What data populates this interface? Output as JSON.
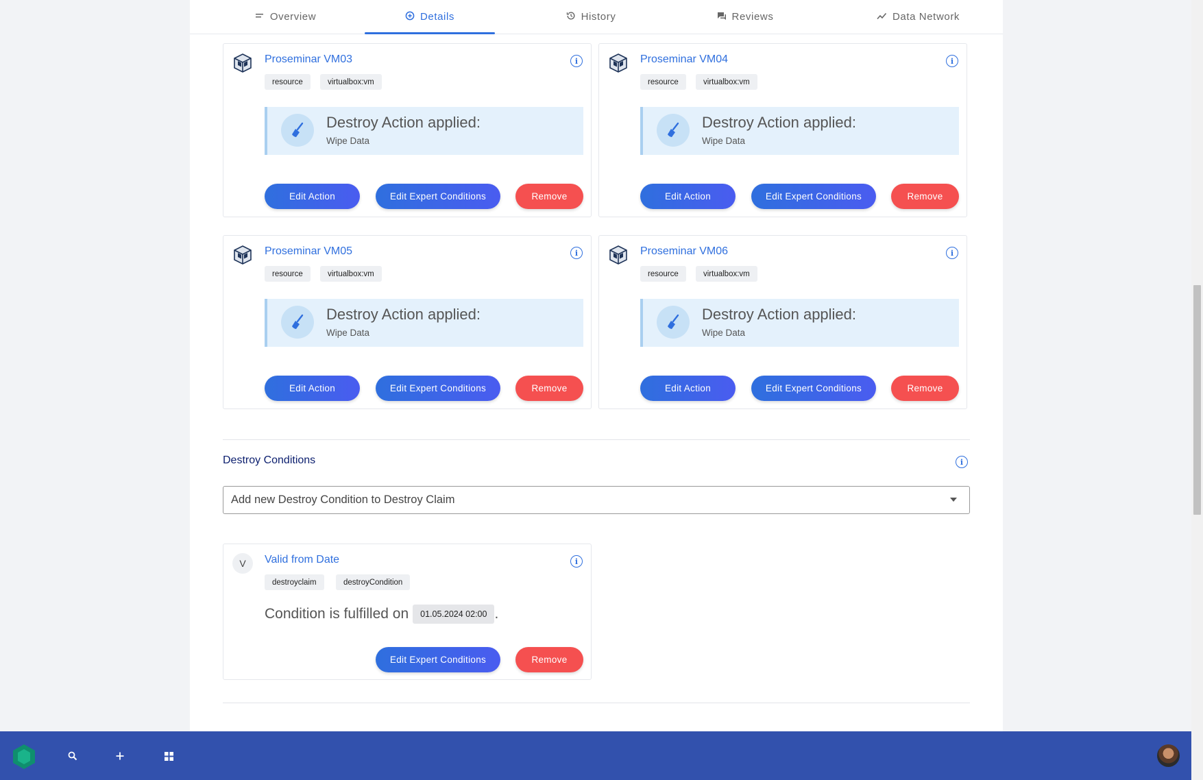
{
  "tabs": [
    {
      "label": "Overview",
      "icon": "lines-icon"
    },
    {
      "label": "Details",
      "icon": "plus-circle-icon"
    },
    {
      "label": "History",
      "icon": "history-icon"
    },
    {
      "label": "Reviews",
      "icon": "chat-icon"
    },
    {
      "label": "Data Network",
      "icon": "trend-icon"
    }
  ],
  "action_cards": [
    {
      "title": "Proseminar VM03",
      "tags": [
        "resource",
        "virtualbox:vm"
      ],
      "action_heading": "Destroy Action applied:",
      "action_name": "Wipe Data"
    },
    {
      "title": "Proseminar VM04",
      "tags": [
        "resource",
        "virtualbox:vm"
      ],
      "action_heading": "Destroy Action applied:",
      "action_name": "Wipe Data"
    },
    {
      "title": "Proseminar VM05",
      "tags": [
        "resource",
        "virtualbox:vm"
      ],
      "action_heading": "Destroy Action applied:",
      "action_name": "Wipe Data"
    },
    {
      "title": "Proseminar VM06",
      "tags": [
        "resource",
        "virtualbox:vm"
      ],
      "action_heading": "Destroy Action applied:",
      "action_name": "Wipe Data"
    }
  ],
  "buttons": {
    "edit_action": "Edit Action",
    "edit_expert": "Edit Expert Conditions",
    "remove": "Remove"
  },
  "conditions": {
    "section_title": "Destroy Conditions",
    "select_placeholder": "Add new Destroy Condition to Destroy Claim",
    "card": {
      "avatar_letter": "V",
      "title": "Valid from Date",
      "tags": [
        "destroyclaim",
        "destroyCondition"
      ],
      "text_prefix": "Condition is fulfilled on",
      "date": "01.05.2024 02:00",
      "text_suffix": "."
    }
  },
  "colors": {
    "accent": "#2f6fde",
    "danger": "#f55050",
    "taskbar": "#3251ad",
    "action_bg": "#e4f1fc"
  }
}
